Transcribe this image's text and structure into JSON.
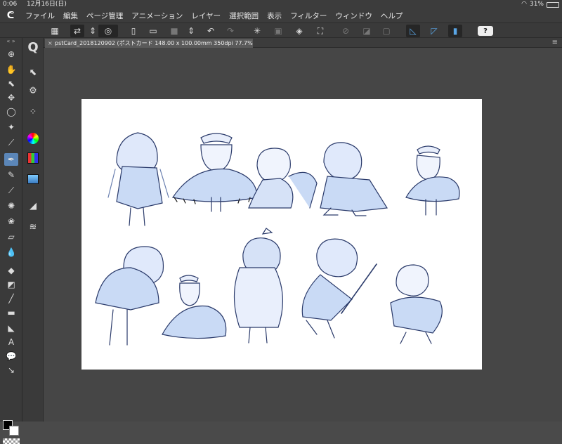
{
  "status": {
    "time": "0:06",
    "date": "12月16日(日)",
    "battery": "31%"
  },
  "menu": {
    "logo": "ᕦ",
    "items": [
      "ファイル",
      "編集",
      "ページ管理",
      "アニメーション",
      "レイヤー",
      "選択範囲",
      "表示",
      "フィルター",
      "ウィンドウ",
      "ヘルプ"
    ]
  },
  "toolbar": {
    "help": "?"
  },
  "document": {
    "tab_title": "pstCard_20181209​02 (ポストカード 148.00 x 100.00mm 350dpi 77.7%)",
    "close": "×",
    "menu": "≡"
  },
  "palette": {
    "collapse_left": "«",
    "collapse_right": "»"
  },
  "colors": {
    "accent": "#5b86b8",
    "panel": "#3a3a3a",
    "canvas": "#ffffff",
    "ink": "#2a3a6a",
    "shade": "#aac4ee"
  }
}
